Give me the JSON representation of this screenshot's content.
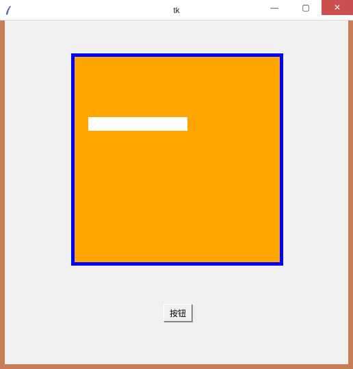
{
  "window": {
    "title": "tk",
    "min_symbol": "—",
    "max_symbol": "▢",
    "close_symbol": "✕"
  },
  "entry": {
    "value": "",
    "placeholder": ""
  },
  "button": {
    "label": "按钮"
  },
  "colors": {
    "frame_bg": "#ffa500",
    "frame_border": "#0000ff",
    "window_chrome": "#c77d58",
    "client_bg": "#f0f0f0",
    "close_bg": "#c8504f"
  }
}
